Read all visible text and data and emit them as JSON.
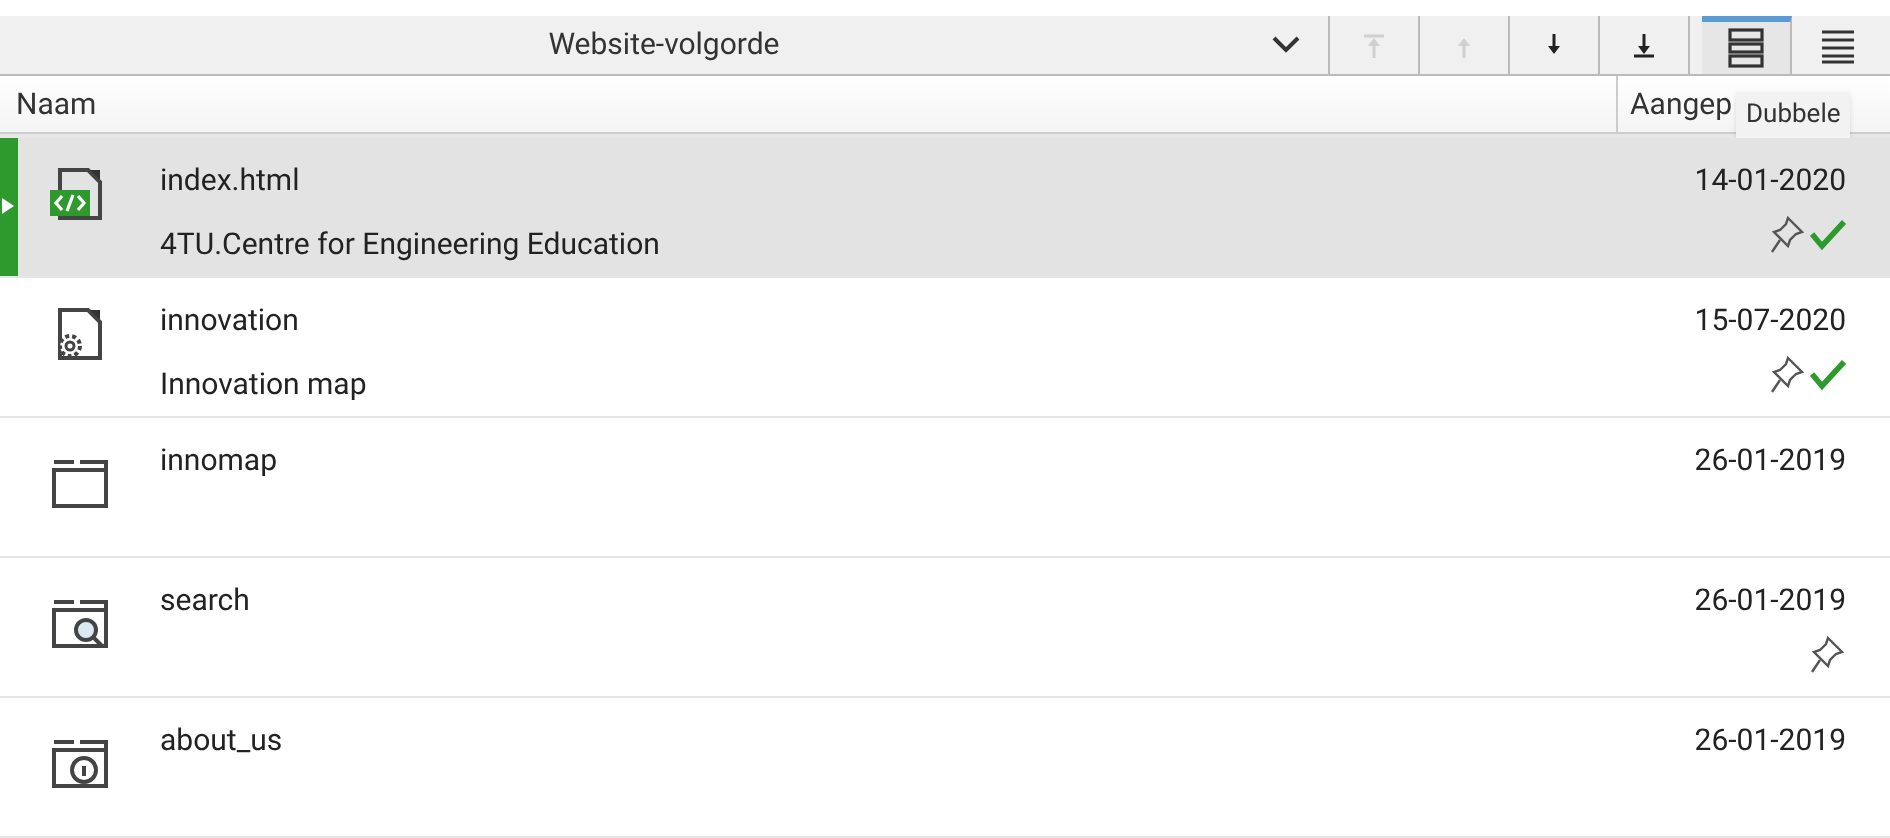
{
  "toolbar": {
    "sort_dropdown": {
      "value": "Website-volgorde"
    },
    "move_buttons": [
      {
        "kind": "top",
        "disabled": true
      },
      {
        "kind": "up",
        "disabled": true
      },
      {
        "kind": "down",
        "disabled": false
      },
      {
        "kind": "bottom",
        "disabled": false
      }
    ],
    "view_buttons": [
      {
        "kind": "double",
        "selected": true
      },
      {
        "kind": "single",
        "selected": false
      }
    ]
  },
  "columns": [
    {
      "label": "Naam"
    },
    {
      "label": "Aangep"
    }
  ],
  "tooltip": "Dubbele",
  "rows": [
    {
      "kind": "html",
      "name": "index.html",
      "title": "4TU.Centre for Engineering Education",
      "date": "14-01-2020",
      "pinned": true,
      "checked": true,
      "selected": true
    },
    {
      "kind": "settings",
      "name": "innovation",
      "title": "Innovation map",
      "date": "15-07-2020",
      "pinned": true,
      "checked": true,
      "selected": false
    },
    {
      "kind": "folder",
      "name": "innomap",
      "date": "26-01-2019",
      "pinned": false,
      "checked": false,
      "selected": false
    },
    {
      "kind": "search",
      "name": "search",
      "date": "26-01-2019",
      "pinned": true,
      "checked": false,
      "selected": false
    },
    {
      "kind": "info",
      "name": "about_us",
      "date": "26-01-2019",
      "pinned": false,
      "checked": false,
      "selected": false
    }
  ]
}
